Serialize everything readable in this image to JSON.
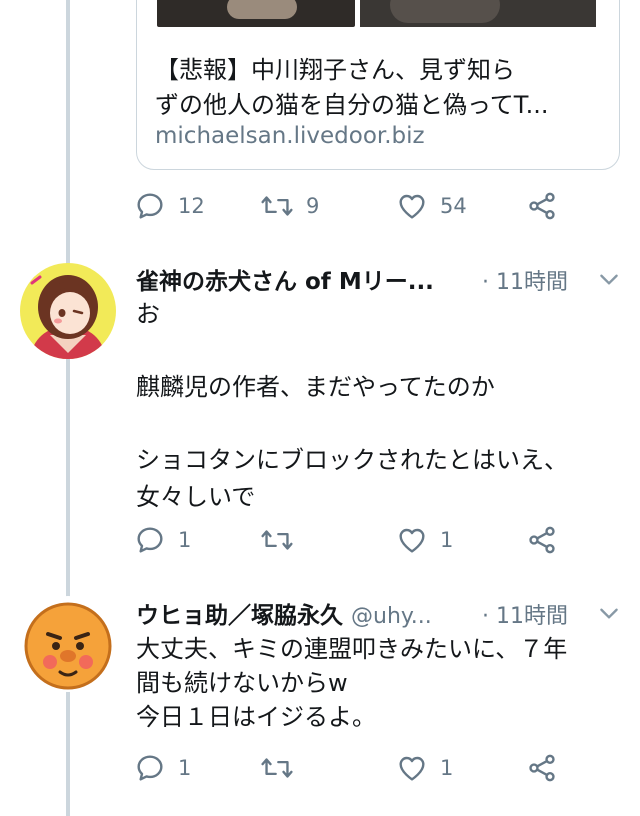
{
  "link_card": {
    "title_line1": "【悲報】中川翔子さん、見ず知ら",
    "title_line2": "ずの他人の猫を自分の猫と偽ってT...",
    "domain": "michaelsan.livedoor.biz"
  },
  "first_tweet_actions": {
    "reply_count": "12",
    "retweet_count": "9",
    "like_count": "54"
  },
  "tweets": [
    {
      "display_name": "雀神の赤犬さん of Mリー...",
      "handle": "",
      "time": "· 11時間",
      "body": [
        "お",
        "",
        "麒麟児の作者、まだやってたのか",
        "",
        "ショコタンにブロックされたとはいえ、",
        "女々しいで"
      ],
      "reply_count": "1",
      "retweet_count": "",
      "like_count": "1"
    },
    {
      "display_name": "ウヒョ助／塚脇永久",
      "handle": "@uhy...",
      "time": "· 11時間",
      "body": [
        "大丈夫、キミの連盟叩きみたいに、７年",
        "間も続けないからw",
        "今日１日はイジるよ。"
      ],
      "reply_count": "1",
      "retweet_count": "",
      "like_count": "1"
    }
  ],
  "colors": {
    "text": "#14171a",
    "secondary": "#657786",
    "border": "#ccd6dd"
  },
  "icons": [
    "reply-icon",
    "retweet-icon",
    "like-icon",
    "share-icon",
    "chevron-down-icon"
  ]
}
